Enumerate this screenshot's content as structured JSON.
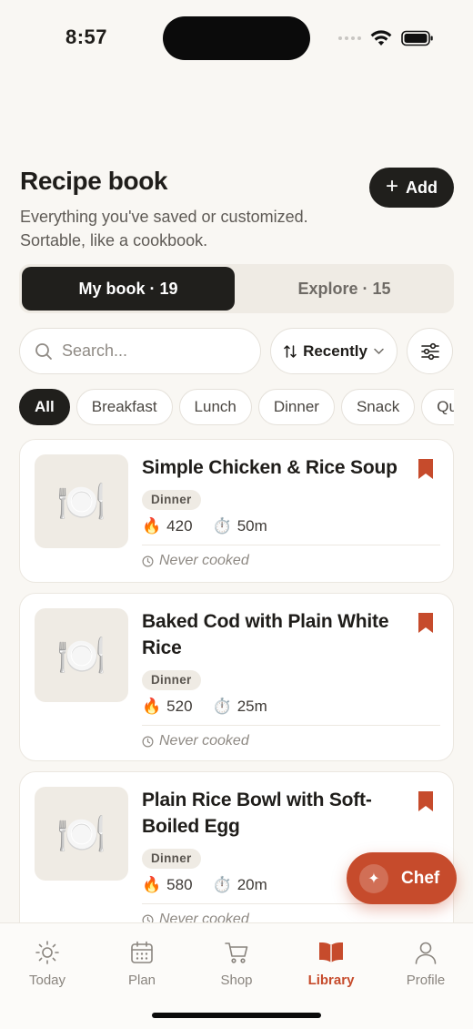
{
  "status": {
    "time": "8:57"
  },
  "header": {
    "title": "Recipe book",
    "subtitle": "Everything you've saved or customized. Sortable, like a cookbook.",
    "add_label": "Add",
    "add_icon": "plus-icon"
  },
  "segments": {
    "mine": "My book · 19",
    "explore": "Explore · 15"
  },
  "search": {
    "placeholder": "Search..."
  },
  "sort": {
    "label": "Recently"
  },
  "chips": [
    "All",
    "Breakfast",
    "Lunch",
    "Dinner",
    "Snack",
    "Qu"
  ],
  "recipes": [
    {
      "title": "Simple Chicken & Rice Soup",
      "tag": "Dinner",
      "calories": "420",
      "time": "50m",
      "cooked": "Never cooked",
      "thumb_icon": "plate-icon",
      "bookmarked": true
    },
    {
      "title": "Baked Cod with Plain White Rice",
      "tag": "Dinner",
      "calories": "520",
      "time": "25m",
      "cooked": "Never cooked",
      "thumb_icon": "plate-icon",
      "bookmarked": true
    },
    {
      "title": "Plain Rice Bowl with Soft-Boiled Egg",
      "tag": "Dinner",
      "calories": "580",
      "time": "20m",
      "cooked": "Never cooked",
      "thumb_icon": "plate-icon",
      "bookmarked": true
    }
  ],
  "chef": {
    "label": "Chef"
  },
  "tabs": [
    {
      "label": "Today",
      "icon": "sun-icon"
    },
    {
      "label": "Plan",
      "icon": "calendar-icon"
    },
    {
      "label": "Shop",
      "icon": "cart-icon"
    },
    {
      "label": "Library",
      "icon": "book-icon",
      "active": true
    },
    {
      "label": "Profile",
      "icon": "person-icon"
    }
  ],
  "colors": {
    "accent": "#c64b2c",
    "dark": "#201f1c",
    "background": "#f9f7f3"
  }
}
